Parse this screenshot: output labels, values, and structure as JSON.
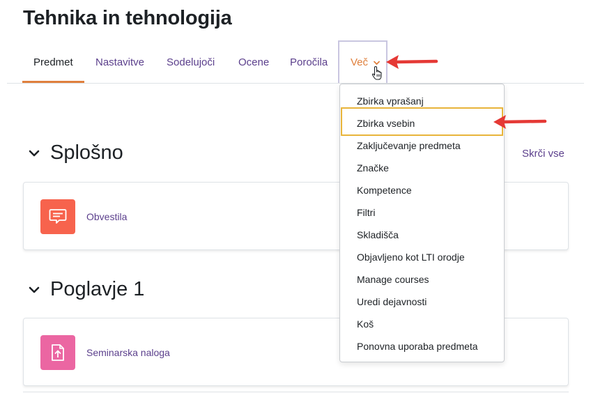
{
  "course": {
    "title": "Tehnika in tehnologija"
  },
  "tabs": [
    {
      "label": "Predmet",
      "active": true
    },
    {
      "label": "Nastavitve"
    },
    {
      "label": "Sodelujoči"
    },
    {
      "label": "Ocene"
    },
    {
      "label": "Poročila"
    },
    {
      "label": "Več",
      "has_dropdown": true
    }
  ],
  "more_menu": {
    "items": [
      "Zbirka vprašanj",
      "Zbirka vsebin",
      "Zaključevanje predmeta",
      "Značke",
      "Kompetence",
      "Filtri",
      "Skladišča",
      "Objavljeno kot LTI orodje",
      "Manage courses",
      "Uredi dejavnosti",
      "Koš",
      "Ponovna uporaba predmeta"
    ],
    "highlighted_item": "Zbirka vsebin"
  },
  "sections": [
    {
      "title": "Splošno",
      "activities": [
        {
          "name": "Obvestila",
          "icon": "forum-icon",
          "icon_color": "#f7634d"
        }
      ]
    },
    {
      "title": "Poglavje 1",
      "activities": [
        {
          "name": "Seminarska naloga",
          "icon": "assignment-upload-icon",
          "icon_color": "#eb66a2"
        }
      ]
    }
  ],
  "actions": {
    "collapse_all": "Skrči vse"
  },
  "colors": {
    "accent": "#e0803d",
    "link": "#5b3f8c",
    "annotation_arrow": "#e53935",
    "highlight_border": "#e8b43a"
  }
}
